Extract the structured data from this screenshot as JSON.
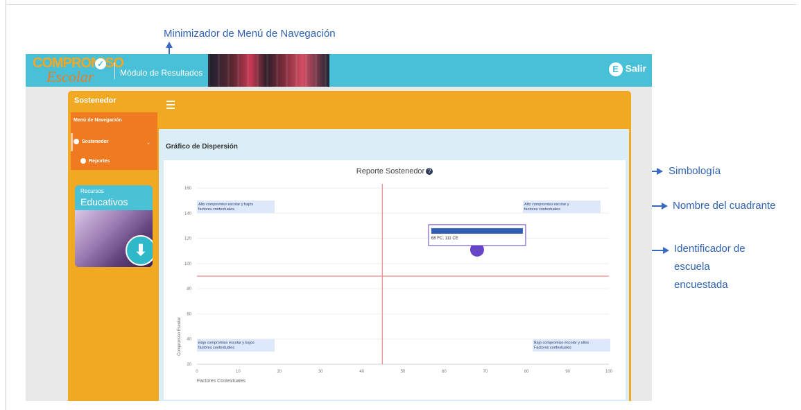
{
  "annotations": {
    "menu_minimizer": "Minimizador de Menú de Navegación",
    "legend_symbol": "Simbología",
    "quadrant_name": "Nombre del cuadrante",
    "school_id_line1": "Identificador de",
    "school_id_line2": "escuela",
    "school_id_line3": "encuestada"
  },
  "header": {
    "logo_line1": "COMPROMISO",
    "logo_line2": "Escolar",
    "module_title": "Módulo de Resultados",
    "logout_label": "Salir",
    "logout_icon": "logout-icon"
  },
  "sidebar": {
    "panel_title": "Sostenedor",
    "nav_heading": "Menú de Navegación",
    "items": [
      {
        "label": "Sostenedor",
        "icon": "user-icon"
      },
      {
        "label": "Reportes",
        "icon": "report-icon"
      }
    ],
    "resources_line1": "Recursos",
    "resources_line2": "Educativos",
    "download_icon": "download-icon"
  },
  "content": {
    "section_title": "Gráfico de Dispersión"
  },
  "chart_data": {
    "type": "scatter",
    "title": "Reporte Sostenedor",
    "xlabel": "Factores Contextuales",
    "ylabel": "Compromiso Escolar",
    "xlim": [
      0,
      100
    ],
    "ylim": [
      20,
      160
    ],
    "x_ticks": [
      0,
      10,
      20,
      30,
      40,
      50,
      60,
      70,
      80,
      90,
      100
    ],
    "y_ticks": [
      20,
      40,
      60,
      80,
      100,
      120,
      140,
      160
    ],
    "reference_lines": {
      "x": 45,
      "y": 90
    },
    "points": [
      {
        "x": 68,
        "y": 111,
        "label": "68 FC, 111 CE"
      }
    ],
    "quadrants": {
      "top_left": [
        "Alto compromiso escolar y bajos",
        "factores contextuales"
      ],
      "top_right": [
        "Alto compromiso escolar y",
        "factores contextuales"
      ],
      "bottom_left": [
        "Bajo compromiso escolar y bajos",
        "factores contextuales"
      ],
      "bottom_right": [
        "Bajo compromiso escolar y altos",
        "Factores contextuales"
      ]
    },
    "colors": {
      "point": "#6646c7",
      "reference": "#ef8b8b",
      "quadrant_bg": "#dde8fb"
    },
    "grid": true
  }
}
